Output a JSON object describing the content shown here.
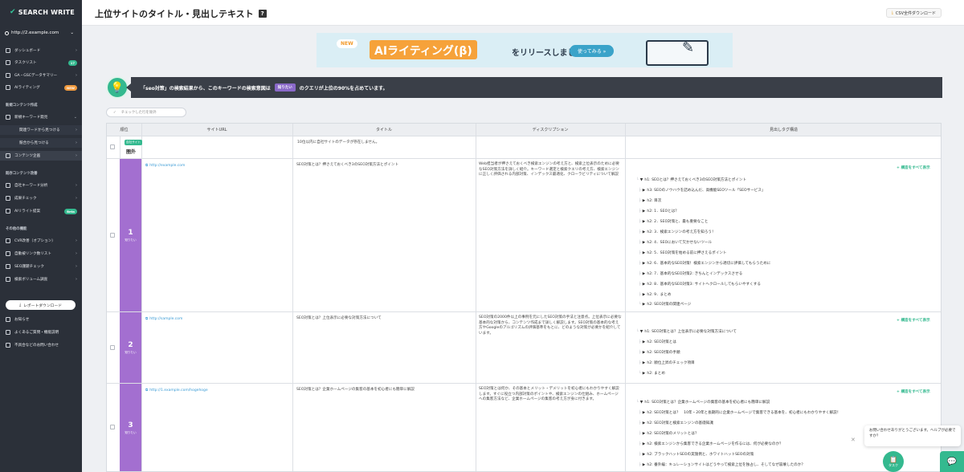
{
  "sidebar": {
    "logo": "SEARCH WRITE",
    "site": "http://2.example.com",
    "items": [
      {
        "label": "ダッシュボード"
      },
      {
        "label": "タスクリスト",
        "badge": "17"
      },
      {
        "label": "GA・GSCデータサマリー"
      },
      {
        "label": "AIライティング",
        "badge": "NEW"
      }
    ],
    "sec1": "新規コンテンツ作成",
    "sec1_items": [
      {
        "label": "新規キーワード発見"
      },
      {
        "label": "関連ワードから見つける"
      },
      {
        "label": "競合から見つける"
      },
      {
        "label": "コンテンツ企画"
      }
    ],
    "sec2": "既存コンテンツ改善",
    "sec2_items": [
      {
        "label": "自社キーワード分析"
      },
      {
        "label": "成果チェック"
      },
      {
        "label": "AIリライト提案",
        "badge": "Beta"
      }
    ],
    "sec3": "その他の機能",
    "sec3_items": [
      {
        "label": "CVR改善（オプション）"
      },
      {
        "label": "自動被リンク数リスト"
      },
      {
        "label": "SEO課題チェック"
      },
      {
        "label": "検索ボリューム調査"
      }
    ],
    "report_btn": "レポートダウンロード",
    "footer": [
      {
        "label": "お知らせ"
      },
      {
        "label": "よくあるご質問・機能説明"
      },
      {
        "label": "不具合などのお問い合わせ"
      }
    ]
  },
  "header": {
    "title": "上位サイトのタイトル・見出しテキスト",
    "csv": "CSV全件ダウンロード"
  },
  "banner": {
    "new": "NEW",
    "ai": "AIライティング(β)",
    "release": "をリリースしました！",
    "try": "使ってみる »"
  },
  "intent": {
    "prefix": "「seo対策」の検索結果から、このキーワードの検索意図は",
    "tag": "知りたい",
    "suffix": "のクエリが上位の90%を占めています。"
  },
  "filter": {
    "label": "チェックした行を除外"
  },
  "table": {
    "headers": [
      "順位",
      "サイトURL",
      "タイトル",
      "ディスクリプション",
      "見出しタグ構造"
    ],
    "own_row": {
      "badge": "自社サイト",
      "rank": "圏外",
      "message": "10位以内に自社サイトのデータが存在しません。"
    },
    "show_all": "+ 構造をすべて表示",
    "rows": [
      {
        "rank": "1",
        "tag": "知りたい",
        "url": "http://example.com",
        "title": "SEO対策とは？押さえておくべき3のSEO対策方法とポイント",
        "desc": "Web担当者が押さえておくべき検索エンジンの考え方と、検索上位表示のために必要なSEO対策方法を詳しく紹介。キーワード選定と検索クエリの考え方、検索エンジンに正しく評価される内部対策、インデックス最適化、クローラビリティについて解説",
        "tree": [
          "h1: SEOとは？押さえておくべき3のSEO対策方法とポイント",
          "h3: SEOのノウハウを詰め込んだ、高機能SEOツール「SEOサービス」",
          "h2: 目次",
          "h2: 1．SEOとは？",
          "h2: 2．SEO対策と、最も重要なこと",
          "h2: 3．検索エンジンの考え方を知ろう！",
          "h2: 4．SEOにおいて欠かせないツール",
          "h2: 5．SEO対策を始める前に押さえるポイント",
          "h2: 6．基本的なSEO対策！検索エンジンから適切に評価してもらうために",
          "h2: 7．基本的なSEO対策2: きちんとインデックスさせる",
          "h2: 8．基本的なSEO対策3: サイトへクロールしてもらいやすくする",
          "h2: 9．まとめ",
          "h2: SEO対策の関連ページ"
        ]
      },
      {
        "rank": "2",
        "tag": "知りたい",
        "url": "http://sample.com",
        "title": "SEO対策とは？上位表示に必要な対策方法について",
        "desc": "SEO対策の2000件以上の事例を元にしたSEO対策の手法と注意点。上位表示に必要な基本的な対策から、コンテンツ作成まで詳しく解説します。SEO対策の基本的な考え方やGoogleのアルゴリズムの評価基準をもとに、どのような対策が必要かを紹介しています。",
        "tree": [
          "h1: SEO対策とは？上位表示に必要な対策方法について",
          "h2: SEO対策とは",
          "h2: SEO対策の手順",
          "h2: 順位上昇のチェック項目",
          "h2: まとめ"
        ]
      },
      {
        "rank": "3",
        "tag": "知りたい",
        "url": "http://1.example.com/hogehoge",
        "title": "SEO対策とは？企業ホームページの集客の基本を初心者にも簡単に解説",
        "desc": "SEO対策とは何か、その基本とメリット・デメリットを初心者にもわかりやすく解説します。すぐに役立つ内部対策のポイントや、検索エンジンの仕組み、ホームページへの集客方法など、企業ホームページの集客の考え方が身に付きます。",
        "tree": [
          "h1: SEO対策とは？企業ホームページの集客の基本を初心者にも簡単に解説",
          "h2: SEO対策とは？　10年・20年と長期的に企業ホームページで集客できる基本を、初心者にもわかりやすく解説！",
          "h2: SEO対策と検索エンジンの基礎知識",
          "h2: SEO対策のメリットとは？",
          "h2: 検索エンジンから集客できる企業ホームページを作るには、何が必要なのか？",
          "h2: ブラックハットSEOの実施例と、ホワイトハットSEOの対策",
          "h2: 番外編：キュレーションサイトはどうやって検索上位を独占し、そしてなぜ崩壊したのか？"
        ]
      }
    ]
  },
  "chat": {
    "tooltip": "お問い合わせありがとうございます。ヘルプが必要ですか？",
    "task": "タスク"
  },
  "colors": {
    "accent": "#34b98f",
    "purple": "#a36fd0",
    "sidebar": "#2b3039"
  }
}
